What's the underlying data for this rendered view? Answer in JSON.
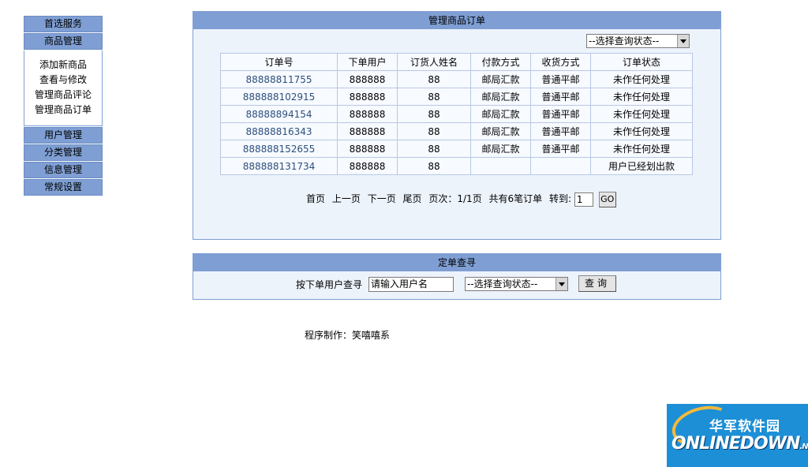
{
  "sidebar": {
    "section1": "首选服务",
    "section2": "商品管理",
    "sub": [
      "添加新商品",
      "查看与修改",
      "管理商品评论",
      "管理商品订单"
    ],
    "section3": "用户管理",
    "section4": "分类管理",
    "section5": "信息管理",
    "section6": "常规设置"
  },
  "orders_panel": {
    "title": "管理商品订单",
    "status_select": "--选择查询状态--",
    "columns": [
      "订单号",
      "下单用户",
      "订货人姓名",
      "付款方式",
      "收货方式",
      "订单状态"
    ],
    "rows": [
      [
        "88888811755",
        "888888",
        "88",
        "邮局汇款",
        "普通平邮",
        "未作任何处理"
      ],
      [
        "888888102915",
        "888888",
        "88",
        "邮局汇款",
        "普通平邮",
        "未作任何处理"
      ],
      [
        "88888894154",
        "888888",
        "88",
        "邮局汇款",
        "普通平邮",
        "未作任何处理"
      ],
      [
        "88888816343",
        "888888",
        "88",
        "邮局汇款",
        "普通平邮",
        "未作任何处理"
      ],
      [
        "888888152655",
        "888888",
        "88",
        "邮局汇款",
        "普通平邮",
        "未作任何处理"
      ],
      [
        "888888131734",
        "888888",
        "88",
        "",
        "",
        "用户已经划出款"
      ]
    ],
    "pager": {
      "first": "首页",
      "prev": "上一页",
      "next": "下一页",
      "last": "尾页",
      "pages": "页次：1/1页",
      "total": "共有6笔订单",
      "goto": "转到:",
      "page_value": "1",
      "go": "GO"
    }
  },
  "search_panel": {
    "title": "定单查寻",
    "label": "按下单用户查寻",
    "input_value": "请输入用户名",
    "status_select": "--选择查询状态--",
    "query_button": "查询"
  },
  "footer": {
    "credit": "程序制作：笑嘻嘻系"
  },
  "logo": {
    "cn": "华军软件园",
    "en": "ONLINEDOWN",
    "net": ".NET"
  },
  "colors": {
    "header": "#7f9fd4",
    "panel_bg": "#edf3fb",
    "order_id": "#2d4f7c"
  }
}
